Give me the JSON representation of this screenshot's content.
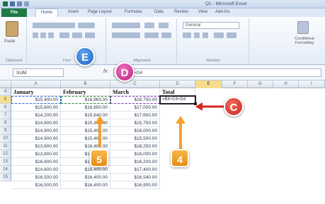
{
  "window": {
    "title": "Q1 - Microsoft Excel"
  },
  "ribbon": {
    "tabs": [
      {
        "label": "File"
      },
      {
        "label": "Home"
      },
      {
        "label": "Insert"
      },
      {
        "label": "Page Layout"
      },
      {
        "label": "Formulas"
      },
      {
        "label": "Data"
      },
      {
        "label": "Review"
      },
      {
        "label": "View"
      },
      {
        "label": "Add-Ins"
      }
    ],
    "groups": {
      "clipboard": "Clipboard",
      "font": "Font",
      "alignment": "Alignment",
      "number": "Number",
      "number_format": "General",
      "styles": "Conditional Formatting"
    },
    "paste_label": "Paste"
  },
  "formula_bar": {
    "name_box": "SUM",
    "fx": "fx",
    "formula": "=B4+C4+D4"
  },
  "columns": [
    "A",
    "B",
    "C",
    "D",
    "E",
    "F",
    "G",
    "H",
    "I"
  ],
  "rows": [
    "4",
    "5",
    "6",
    "7",
    "8",
    "9",
    "10",
    "11",
    "12",
    "13",
    "14",
    "15"
  ],
  "sheet": {
    "headers": [
      "January",
      "February",
      "March",
      "Total"
    ],
    "data": [
      [
        "$15,400.00",
        "$16,963.00",
        "$18,750.00",
        "=B4+C4+D4"
      ],
      [
        "$15,600.00",
        "$16,850.00",
        "$17,000.00",
        ""
      ],
      [
        "$14,200.00",
        "$15,640.00",
        "$17,650.00",
        ""
      ],
      [
        "$14,800.00",
        "$15,300.00",
        "$15,750.00",
        ""
      ],
      [
        "$14,900.00",
        "$15,400.00",
        "$16,000.00",
        ""
      ],
      [
        "$14,900.00",
        "$15,400.00",
        "$15,500.00",
        ""
      ],
      [
        "$13,600.00",
        "$16,400.00",
        "$18,250.00",
        ""
      ],
      [
        "$13,800.00",
        "$15,800.00",
        "$16,000.00",
        ""
      ],
      [
        "$16,800.00",
        "$16,200.00",
        "$16,200.00",
        ""
      ],
      [
        "$14,600.00",
        "$16,400.00",
        "$17,400.00",
        ""
      ],
      [
        "$16,500.00",
        "$16,400.00",
        "$16,540.00",
        ""
      ],
      [
        "$16,500.00",
        "$16,400.00",
        "$16,900.00",
        ""
      ]
    ]
  },
  "callouts": {
    "e": "E",
    "d": "D",
    "c": "C",
    "five": "5",
    "four": "4"
  },
  "colors": {
    "file_tab": "#1f7a44",
    "callout_blue": "#1d66c2",
    "callout_pink": "#b8237f",
    "callout_red": "#c2261c",
    "callout_orange": "#e88b12",
    "arrow": "#d4241b",
    "step_arrow": "#f3a12b"
  }
}
